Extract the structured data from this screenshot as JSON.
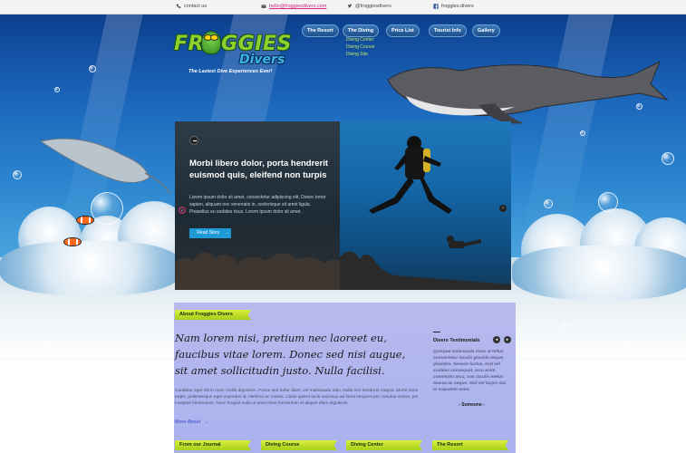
{
  "topbar": {
    "contact": "contact us",
    "email": "hello@froggiesdivers.com",
    "twitter": "@froggiesdivers",
    "facebook": "froggies.divers"
  },
  "logo": {
    "line1": "FROGGIES",
    "line2": "Divers",
    "tagline": "The Laziest Dive Experiences Ever!"
  },
  "nav": {
    "items": [
      "The Resort",
      "The Diving",
      "Price List",
      "Tourist Info",
      "Gallery"
    ],
    "diving_submenu": [
      "Diving Center",
      "Diving Course",
      "Diving Site"
    ]
  },
  "hero": {
    "title": "Morbi libero dolor, porta hendrerit euismod quis, eleifend non turpis",
    "body": "Lorem ipsum dolor sit amet, consectetur adipiscing elit. Donec tortor sapien, aliquam nec venenatis in, scelerisque sit amet ligula. Phasellus eu sodales risus. Lorem ipsum dolor sit amet.",
    "button_label": "Read Story",
    "button_arrow": "→"
  },
  "about": {
    "ribbon": "About Froggies Divers",
    "heading": "Nam lorem nisi, pretium nec laoreet eu, faucibus vitae lorem. Donec sed nisi augue, sit amet sollicitudin justo. Nulla facilisi.",
    "body": "Curabitur eget elit in nunc mollis dignissim. Fusce sed tortor diam, vel malesuada odio. Nulla nec hendrerit magna. Morbi tortor turpis, pellentesque eget imperdiet id, eleifend ac massa. Class aptent taciti sociosqu ad litora torquent per conubia nostra, per inceptos himenaeos. Nunc feugiat nulla ut amet risus fermentum et aliquet diam dignissim",
    "more_label": "More About",
    "more_arrow": "→"
  },
  "testimonials": {
    "title": "Divers Testimonials",
    "prev": "◂",
    "next": "▸",
    "quote": "Quisque malesuada risus at tellus consectetur iaculis gravida neque pharetra. Aenean luctus, erat vel sodales consequat, arcu enim commodo arcu, non iaculis metus massa ac neque. Sed vel turpis dui, in vulputate enim.",
    "author": "- Someone -"
  },
  "footer_ribbons": [
    "From our Journal",
    "Diving Course",
    "Diving Center",
    "The Resort"
  ],
  "colors": {
    "accent_blue": "#1e9bd7",
    "ribbon_green": "#c4e22c",
    "about_bg": "#b3b6ee",
    "link_pink": "#d22a7a"
  }
}
